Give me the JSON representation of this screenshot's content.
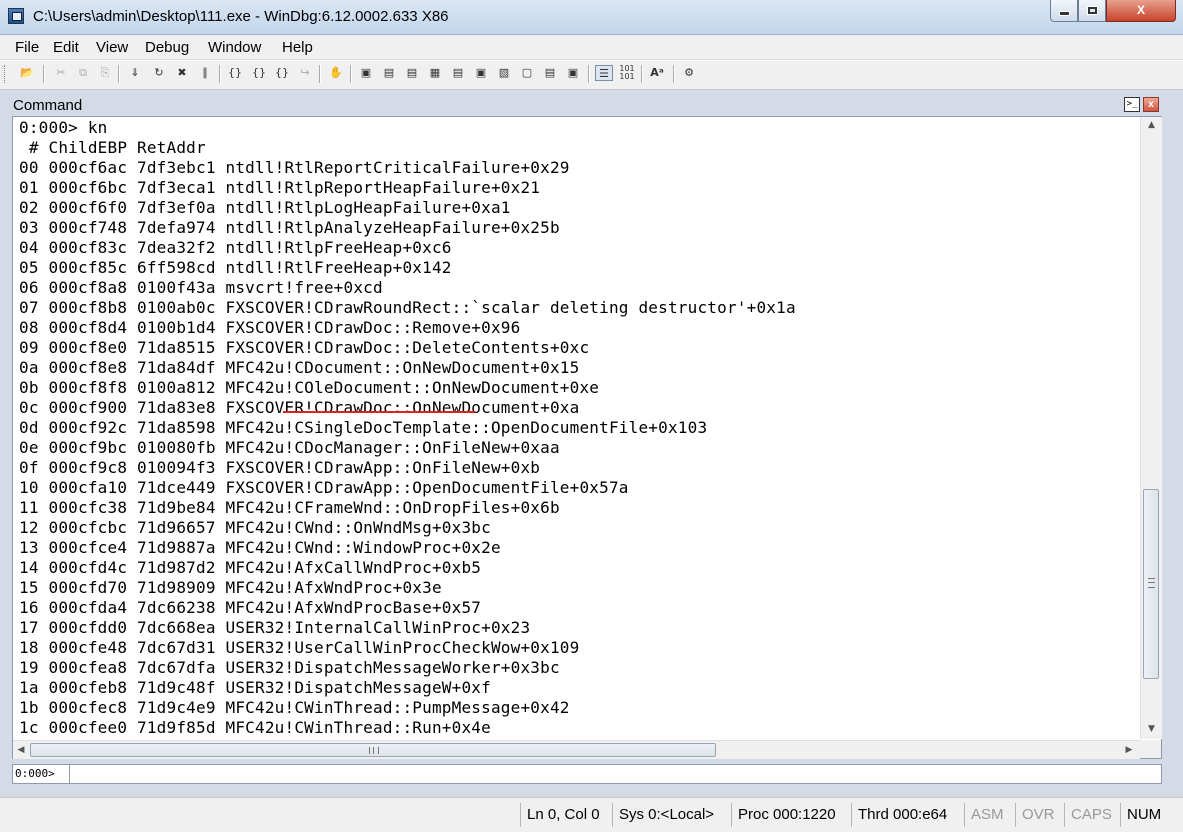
{
  "window": {
    "title": "C:\\Users\\admin\\Desktop\\111.exe - WinDbg:6.12.0002.633 X86",
    "close_label": "X"
  },
  "menu": [
    "File",
    "Edit",
    "View",
    "Debug",
    "Window",
    "Help"
  ],
  "command_pane": {
    "caption": "Command",
    "prompt_button_label": ">_",
    "close_button_label": "x"
  },
  "output": {
    "lines": [
      "0:000> kn",
      " # ChildEBP RetAddr",
      "00 000cf6ac 7df3ebc1 ntdll!RtlReportCriticalFailure+0x29",
      "01 000cf6bc 7df3eca1 ntdll!RtlpReportHeapFailure+0x21",
      "02 000cf6f0 7df3ef0a ntdll!RtlpLogHeapFailure+0xa1",
      "03 000cf748 7defa974 ntdll!RtlpAnalyzeHeapFailure+0x25b",
      "04 000cf83c 7dea32f2 ntdll!RtlpFreeHeap+0xc6",
      "05 000cf85c 6ff598cd ntdll!RtlFreeHeap+0x142",
      "06 000cf8a8 0100f43a msvcrt!free+0xcd",
      "07 000cf8b8 0100ab0c FXSCOVER!CDrawRoundRect::`scalar deleting destructor'+0x1a",
      "08 000cf8d4 0100b1d4 FXSCOVER!CDrawDoc::Remove+0x96",
      "09 000cf8e0 71da8515 FXSCOVER!CDrawDoc::DeleteContents+0xc",
      "0a 000cf8e8 71da84df MFC42u!CDocument::OnNewDocument+0x15",
      "0b 000cf8f8 0100a812 MFC42u!COleDocument::OnNewDocument+0xe",
      "0c 000cf900 71da83e8 FXSCOVER!CDrawDoc::OnNewDocument+0xa",
      "0d 000cf92c 71da8598 MFC42u!CSingleDocTemplate::OpenDocumentFile+0x103",
      "0e 000cf9bc 010080fb MFC42u!CDocManager::OnFileNew+0xaa",
      "0f 000cf9c8 010094f3 FXSCOVER!CDrawApp::OnFileNew+0xb",
      "10 000cfa10 71dce449 FXSCOVER!CDrawApp::OpenDocumentFile+0x57a",
      "11 000cfc38 71d9be84 MFC42u!CFrameWnd::OnDropFiles+0x6b",
      "12 000cfcbc 71d96657 MFC42u!CWnd::OnWndMsg+0x3bc",
      "13 000cfce4 71d9887a MFC42u!CWnd::WindowProc+0x2e",
      "14 000cfd4c 71d987d2 MFC42u!AfxCallWndProc+0xb5",
      "15 000cfd70 71d98909 MFC42u!AfxWndProc+0x3e",
      "16 000cfda4 7dc66238 MFC42u!AfxWndProcBase+0x57",
      "17 000cfdd0 7dc668ea USER32!InternalCallWinProc+0x23",
      "18 000cfe48 7dc67d31 USER32!UserCallWinProcCheckWow+0x109",
      "19 000cfea8 7dc67dfa USER32!DispatchMessageWorker+0x3bc",
      "1a 000cfeb8 71d9c48f USER32!DispatchMessageW+0xf",
      "1b 000cfec8 71d9c4e9 MFC42u!CWinThread::PumpMessage+0x42",
      "1c 000cfee0 71d9f85d MFC42u!CWinThread::Run+0x4e"
    ]
  },
  "input": {
    "prompt": "0:000>",
    "value": ""
  },
  "status": {
    "position": "Ln 0, Col 0",
    "sys": "Sys 0:<Local>",
    "proc": "Proc 000:1220",
    "thrd": "Thrd 000:e64",
    "asm": "ASM",
    "ovr": "OVR",
    "caps": "CAPS",
    "num": "NUM"
  },
  "icons": {
    "toolbar": [
      "open-icon",
      "cut-icon",
      "copy-icon",
      "paste-icon",
      "go-icon",
      "restart-icon",
      "stop-debugging-icon",
      "break-icon",
      "step-into-icon",
      "step-over-icon",
      "step-out-icon",
      "run-to-cursor-icon",
      "set-breakpoint-icon",
      "command-window-icon",
      "watch-icon",
      "locals-icon",
      "registers-icon",
      "memory-icon",
      "call-stack-icon",
      "disassembly-icon",
      "scratch-pad-icon",
      "source-mode-icon",
      "hex-mode-icon",
      "font-icon",
      "options-icon"
    ]
  }
}
